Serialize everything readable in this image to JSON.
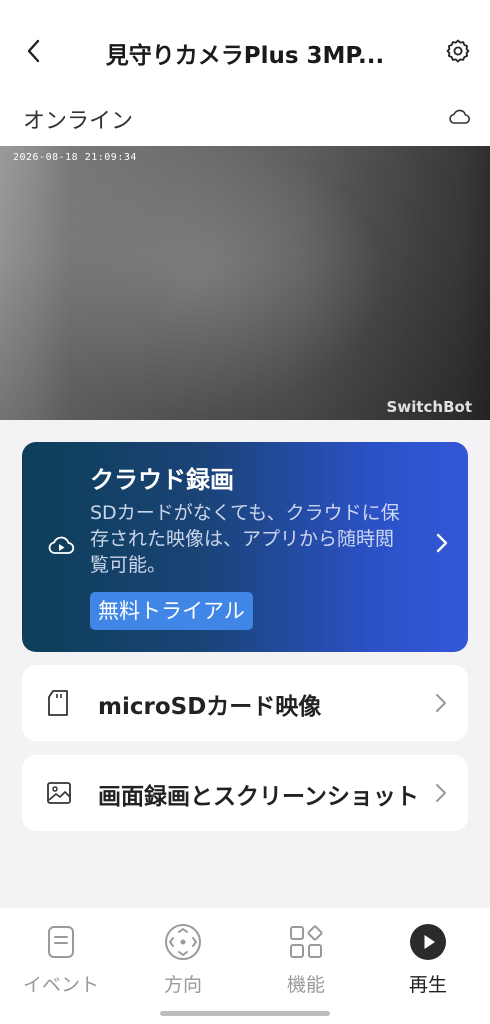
{
  "header": {
    "title": "見守りカメラPlus 3MP...",
    "back_icon": "chevron-left-icon",
    "settings_icon": "gear-icon"
  },
  "status": {
    "text": "オンライン",
    "cloud_icon": "cloud-icon"
  },
  "video": {
    "timestamp": "2026-08-18 21:09:34",
    "watermark": "SwitchBot"
  },
  "cloud_recording": {
    "title": "クラウド録画",
    "description": "SDカードがなくても、クラウドに保存された映像は、アプリから随時閲覧可能。",
    "trial_label": "無料トライアル",
    "icon": "cloud-play-icon"
  },
  "menu": {
    "microsd_label": "microSDカード映像",
    "screen_record_label": "画面録画とスクリーンショット"
  },
  "tabs": {
    "event": "イベント",
    "direction": "方向",
    "features": "機能",
    "playback": "再生"
  },
  "colors": {
    "accent_blue": "#3357d8",
    "card_dark": "#0d3e58",
    "trial_button": "#3f86e6"
  }
}
